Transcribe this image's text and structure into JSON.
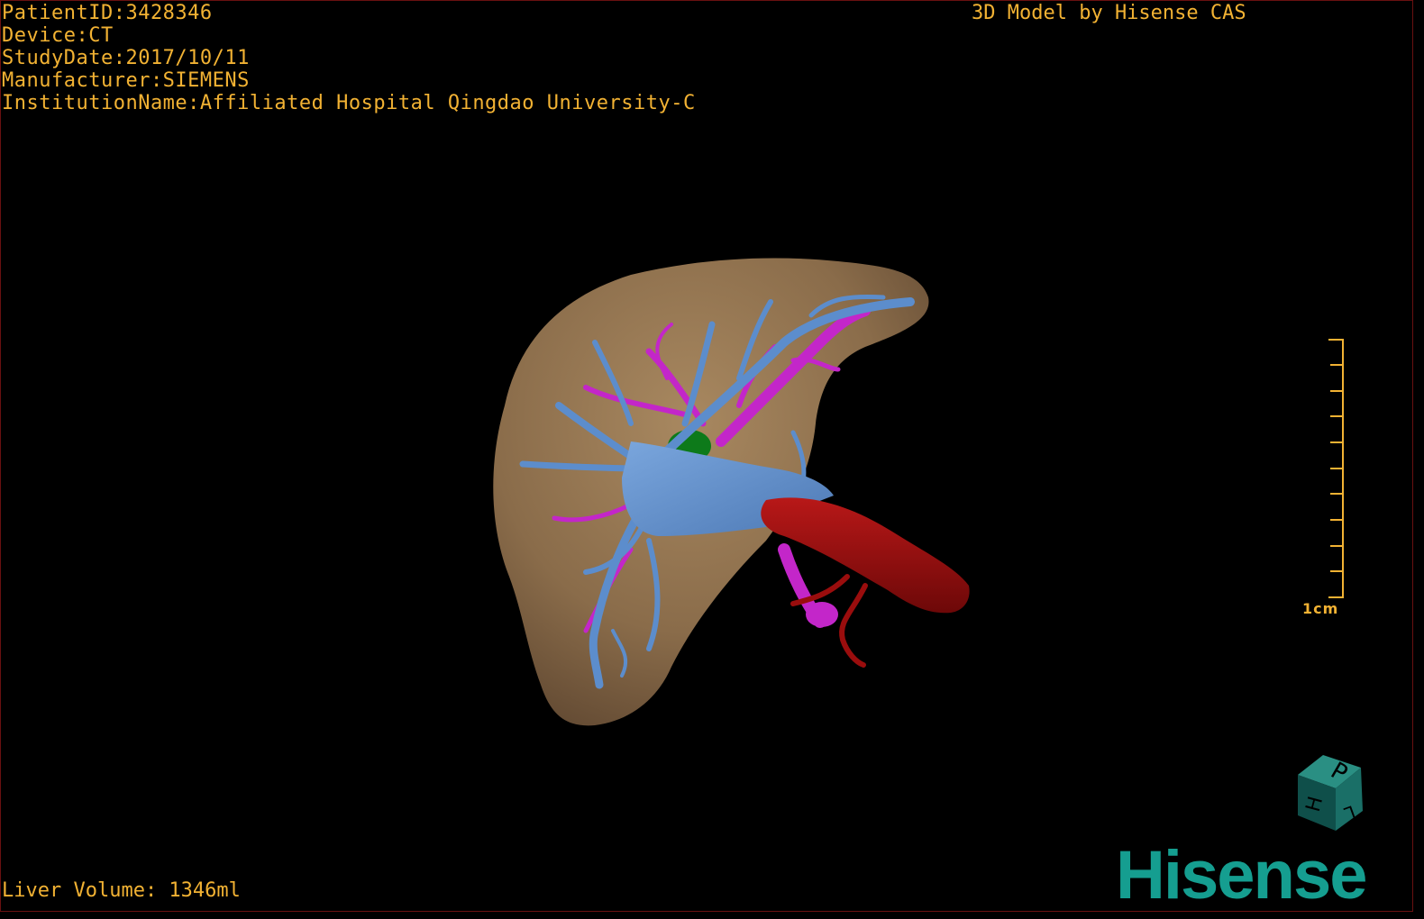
{
  "header": {
    "patient_id": "PatientID:3428346",
    "device": "Device:CT",
    "study_date": "StudyDate:2017/10/11",
    "manufacturer": "Manufacturer:SIEMENS",
    "institution": "InstitutionName:Affiliated Hospital Qingdao University-C"
  },
  "title": "3D Model by Hisense CAS",
  "liver_volume": "Liver Volume: 1346ml",
  "scale_bar": {
    "label": "1cm",
    "tick_count": 11
  },
  "orientation_cube": {
    "faces": [
      "P",
      "H",
      "L"
    ]
  },
  "logo": {
    "text": "Hisense"
  },
  "colors": {
    "overlay_text": "#f2b233",
    "liver": "#8a6c4a",
    "portal_vein": "#5c8dcc",
    "hepatic_artery": "#c326c9",
    "aorta": "#9a0d0d",
    "gallbladder": "#0d7a1a",
    "brand": "#159e90"
  }
}
